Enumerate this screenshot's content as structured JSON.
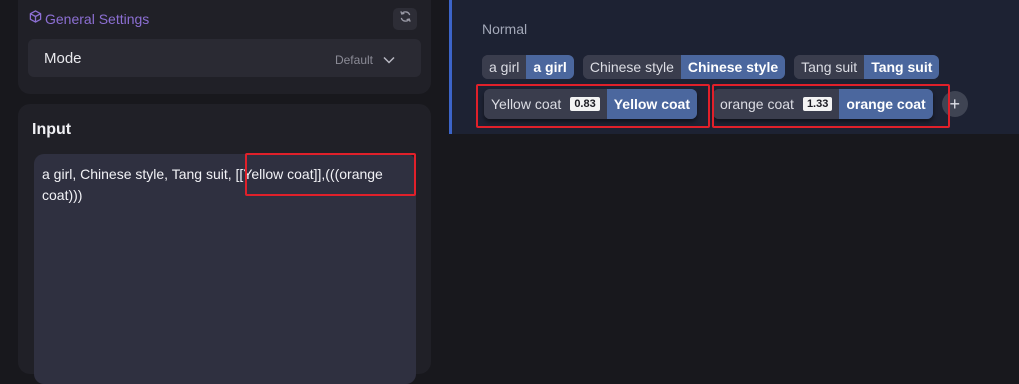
{
  "settings": {
    "title": "General Settings",
    "mode_label": "Mode",
    "mode_value": "Default"
  },
  "input": {
    "title": "Input",
    "lines": [
      "a girl, Chinese style, Tang suit, [[Yellow coat]],(((orange",
      "coat)))"
    ]
  },
  "output": {
    "section_label": "Normal",
    "tags": [
      {
        "src": "a girl",
        "dst": "a girl"
      },
      {
        "src": "Chinese style",
        "dst": "Chinese style"
      },
      {
        "src": "Tang suit",
        "dst": "Tang suit"
      },
      {
        "src": "Yellow coat",
        "weight": "0.83",
        "dst": "Yellow coat"
      },
      {
        "src": "orange coat",
        "weight": "1.33",
        "dst": "orange coat"
      }
    ],
    "add_label": "+"
  },
  "colors": {
    "accent_purple": "#8c6fd3",
    "tag_translated": "#4b679e",
    "highlight_red": "#e0202a",
    "selection_bar": "#3c64c8"
  },
  "icons": [
    "box-icon",
    "refresh-icon",
    "chevron-down-icon",
    "plus-icon"
  ]
}
